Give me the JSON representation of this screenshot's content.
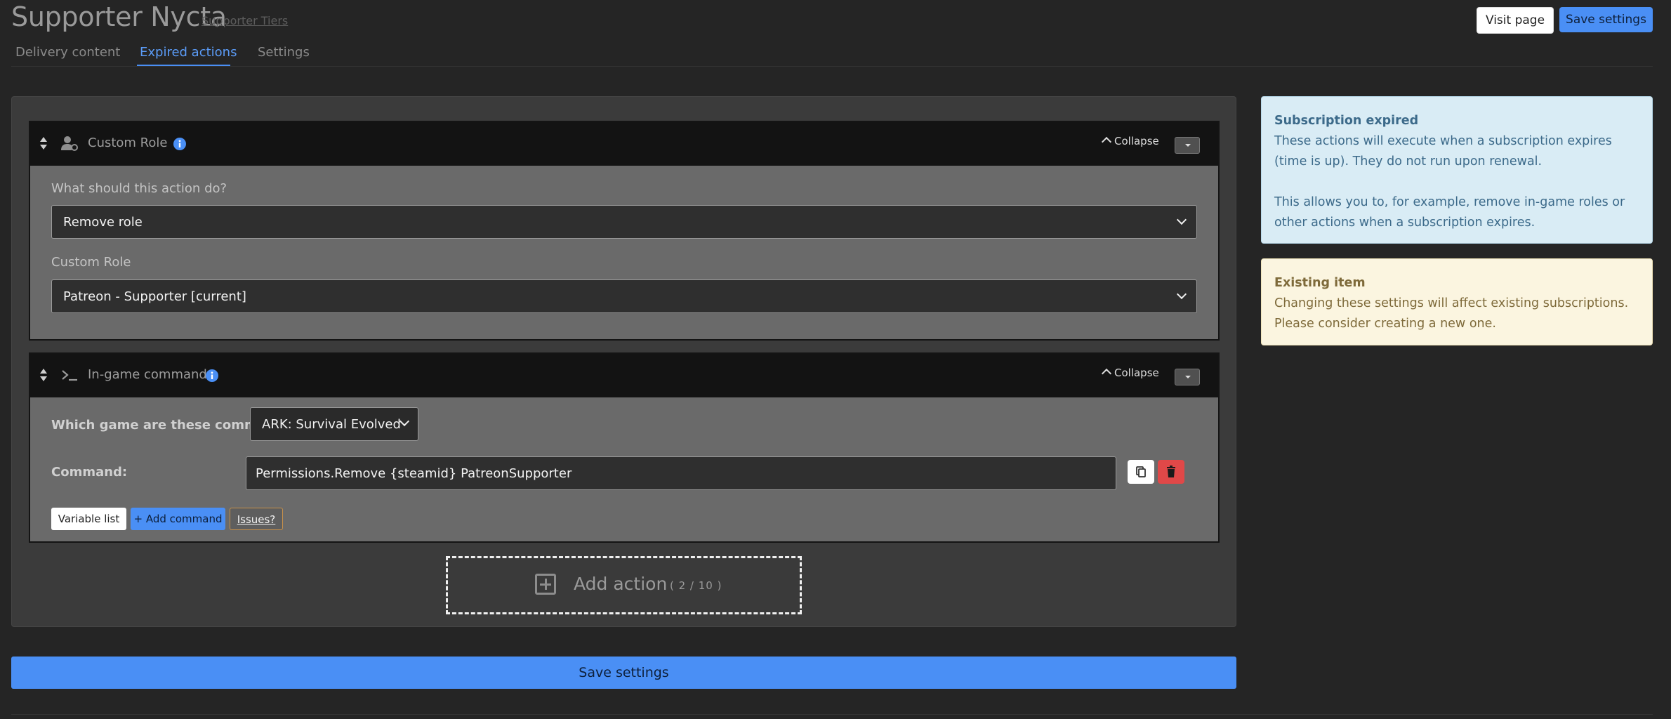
{
  "header": {
    "title": "Supporter Nycta",
    "breadcrumb_link": "Supporter Tiers",
    "visit_label": "Visit page",
    "save_label": "Save settings"
  },
  "tabs": [
    {
      "label": "Delivery content",
      "active": false
    },
    {
      "label": "Expired actions",
      "active": true
    },
    {
      "label": "Settings",
      "active": false
    }
  ],
  "actions": [
    {
      "title": "Custom Role",
      "icon": "user-gear-icon",
      "collapse_label": "Collapse",
      "question_label": "What should this action do?",
      "question_value": "Remove role",
      "role_label": "Custom Role",
      "role_value": "Patreon - Supporter [current]"
    },
    {
      "title": "In-game command",
      "icon": "terminal-icon",
      "collapse_label": "Collapse",
      "game_label": "Which game are these commands for?",
      "game_value": "ARK: Survival Evolved",
      "command_label": "Command:",
      "command_value": "Permissions.Remove {steamid} PatreonSupporter",
      "variable_list_label": "Variable list",
      "add_command_label": "+ Add command",
      "issues_label": "Issues?"
    }
  ],
  "add_action": {
    "label": "Add action",
    "count": "( 2 / 10 )"
  },
  "save_bottom_label": "Save settings",
  "alerts": {
    "info": {
      "heading": "Subscription expired",
      "line1": "These actions will execute when a subscription expires (time is up). They do not run upon renewal.",
      "line2": "This allows you to, for example, remove in-game roles or other actions when a subscription expires."
    },
    "warning": {
      "heading": "Existing item",
      "body": "Changing these settings will affect existing subscriptions. Please consider creating a new one."
    }
  },
  "colors": {
    "accent": "#4a8ff5",
    "danger": "#e04848",
    "background": "#252525",
    "info_bg": "#d9ecf5",
    "warning_bg": "#fbf5e0"
  }
}
